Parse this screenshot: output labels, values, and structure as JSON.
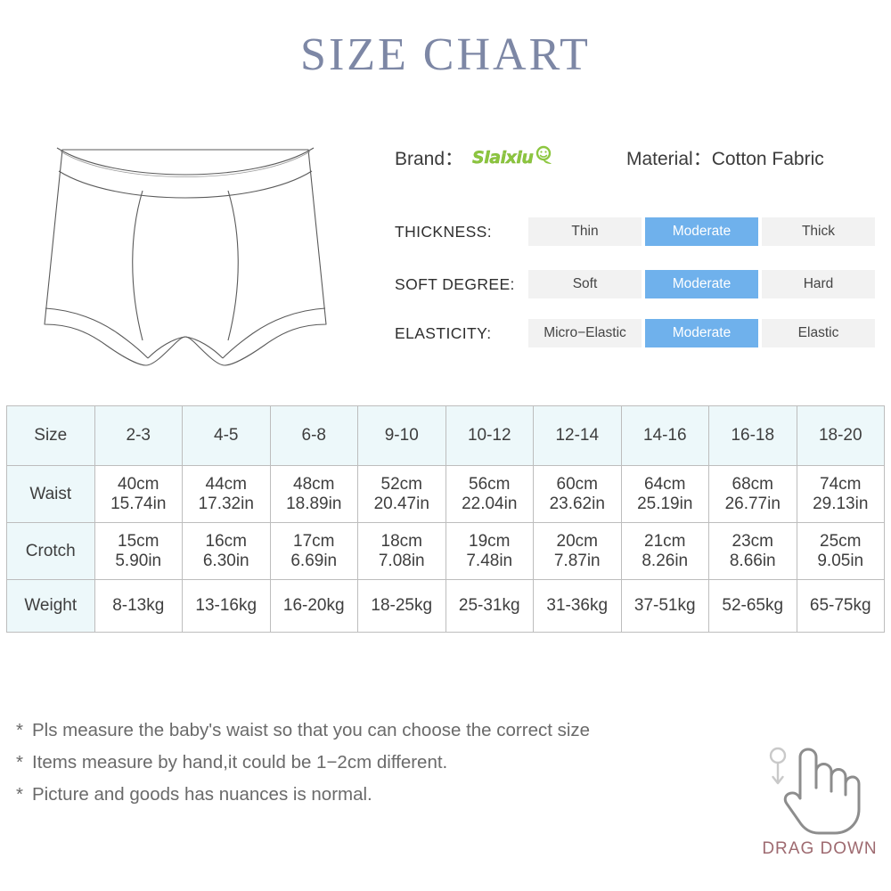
{
  "title": "SIZE CHART",
  "meta": {
    "brand_label": "Brand：",
    "brand_name": "Slaixiu",
    "material_label": "Material：Cotton Fabric"
  },
  "attributes": [
    {
      "label": "THICKNESS:",
      "options": [
        "Thin",
        "Moderate",
        "Thick"
      ],
      "selected": "Moderate"
    },
    {
      "label": "SOFT DEGREE:",
      "options": [
        "Soft",
        "Moderate",
        "Hard"
      ],
      "selected": "Moderate"
    },
    {
      "label": "ELASTICITY:",
      "options": [
        "Micro−Elastic",
        "Moderate",
        "Elastic"
      ],
      "selected": "Moderate"
    }
  ],
  "colors": {
    "title": "#7d87a5",
    "accent_blue": "#6fb1ec",
    "option_bg": "#f2f2f2",
    "table_header_bg": "#edf8fa",
    "table_outer_border": "#cfe8ef",
    "table_grid": "#bdbdbd",
    "note_text": "#6a6a6a",
    "drag_text": "#9e6a70",
    "brand_green": "#8cc63f"
  },
  "table": {
    "header": [
      "Size",
      "2-3",
      "4-5",
      "6-8",
      "9-10",
      "10-12",
      "12-14",
      "14-16",
      "16-18",
      "18-20"
    ],
    "rows": [
      {
        "label": "Waist",
        "cells": [
          {
            "cm": "40cm",
            "in": "15.74in"
          },
          {
            "cm": "44cm",
            "in": "17.32in"
          },
          {
            "cm": "48cm",
            "in": "18.89in"
          },
          {
            "cm": "52cm",
            "in": "20.47in"
          },
          {
            "cm": "56cm",
            "in": "22.04in"
          },
          {
            "cm": "60cm",
            "in": "23.62in"
          },
          {
            "cm": "64cm",
            "in": "25.19in"
          },
          {
            "cm": "68cm",
            "in": "26.77in"
          },
          {
            "cm": "74cm",
            "in": "29.13in"
          }
        ]
      },
      {
        "label": "Crotch",
        "cells": [
          {
            "cm": "15cm",
            "in": "5.90in"
          },
          {
            "cm": "16cm",
            "in": "6.30in"
          },
          {
            "cm": "17cm",
            "in": "6.69in"
          },
          {
            "cm": "18cm",
            "in": "7.08in"
          },
          {
            "cm": "19cm",
            "in": "7.48in"
          },
          {
            "cm": "20cm",
            "in": "7.87in"
          },
          {
            "cm": "21cm",
            "in": "8.26in"
          },
          {
            "cm": "23cm",
            "in": "8.66in"
          },
          {
            "cm": "25cm",
            "in": "9.05in"
          }
        ]
      }
    ],
    "weight_row": {
      "label": "Weight",
      "values": [
        "8-13kg",
        "13-16kg",
        "16-20kg",
        "18-25kg",
        "25-31kg",
        "31-36kg",
        "37-51kg",
        "52-65kg",
        "65-75kg"
      ]
    }
  },
  "notes": [
    "Pls measure the baby's waist so that you can choose the correct size",
    "Items measure by hand,it could be 1−2cm different.",
    "Picture and goods has nuances is normal."
  ],
  "note_marker": "*",
  "drag_hint": {
    "text": "DRAG DOWN"
  }
}
